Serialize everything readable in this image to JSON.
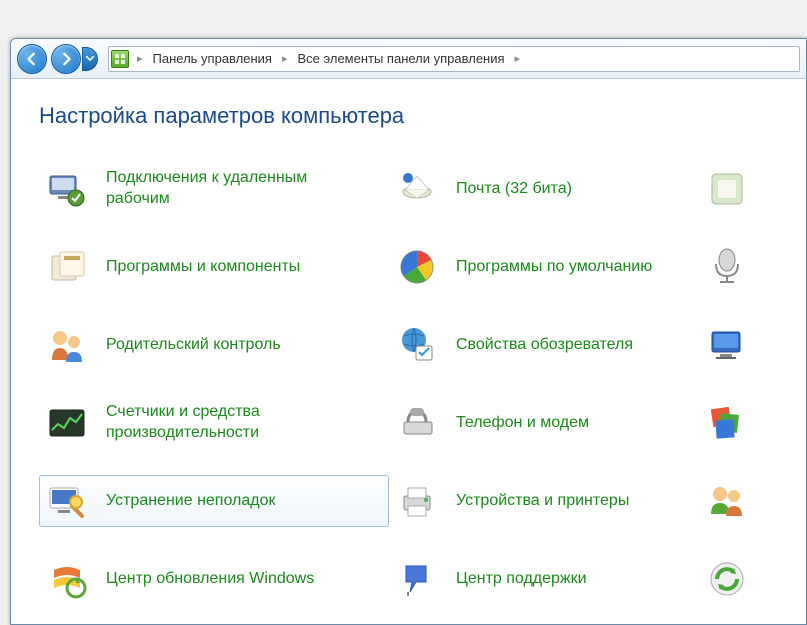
{
  "breadcrumb": {
    "items": [
      "Панель управления",
      "Все элементы панели управления"
    ]
  },
  "heading": "Настройка параметров компьютера",
  "items": {
    "col1": [
      {
        "label": "Подключения к удаленным рабочим"
      },
      {
        "label": "Программы и компоненты"
      },
      {
        "label": "Родительский контроль"
      },
      {
        "label": "Счетчики и средства производительности"
      },
      {
        "label": "Устранение неполадок"
      },
      {
        "label": "Центр обновления Windows"
      }
    ],
    "col2": [
      {
        "label": "Почта (32 бита)"
      },
      {
        "label": "Программы по умолчанию"
      },
      {
        "label": "Свойства обозревателя"
      },
      {
        "label": "Телефон и модем"
      },
      {
        "label": "Устройства и принтеры"
      },
      {
        "label": "Центр поддержки"
      }
    ]
  }
}
